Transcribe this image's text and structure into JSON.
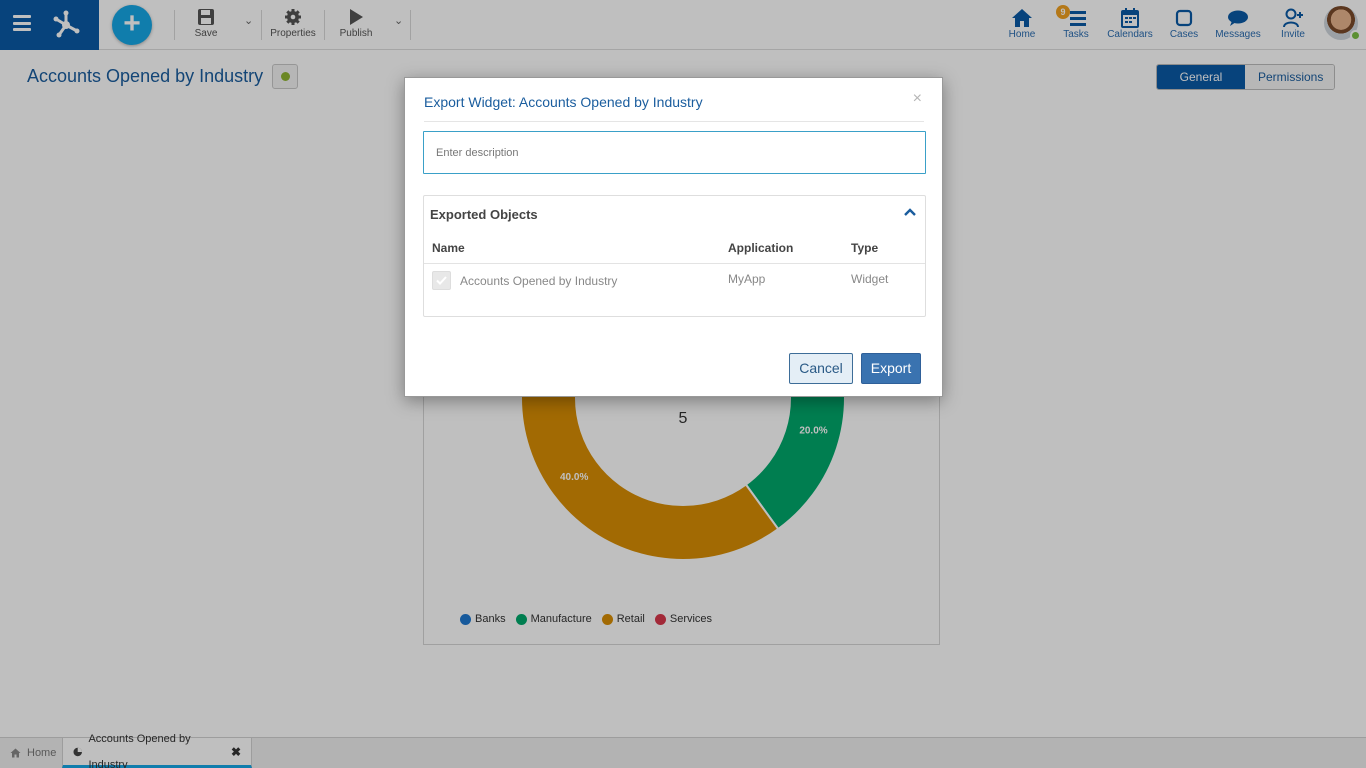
{
  "toolbar": {
    "save_label": "Save",
    "properties_label": "Properties",
    "publish_label": "Publish"
  },
  "nav": {
    "home_label": "Home",
    "tasks_label": "Tasks",
    "tasks_badge": "9",
    "calendars_label": "Calendars",
    "cases_label": "Cases",
    "messages_label": "Messages",
    "invite_label": "Invite"
  },
  "page": {
    "title": "Accounts Opened by Industry",
    "tab_general": "General",
    "tab_permissions": "Permissions"
  },
  "chart_data": {
    "type": "pie",
    "center_value": "5",
    "categories": [
      "Banks",
      "Manufacture",
      "Retail",
      "Services"
    ],
    "colors": [
      "#1f78d1",
      "#00a86b",
      "#d98e04",
      "#d9374b"
    ],
    "visible_slice_labels": [
      {
        "category": "Manufacture",
        "label": "20.0%"
      },
      {
        "category": "Retail",
        "label": "40.0%"
      }
    ],
    "legend_position": "bottom"
  },
  "modal": {
    "title": "Export Widget: Accounts Opened by Industry",
    "close_glyph": "×",
    "description_placeholder": "Enter description",
    "section_title": "Exported Objects",
    "columns": [
      "Name",
      "Application",
      "Type"
    ],
    "rows": [
      {
        "name": "Accounts Opened by Industry",
        "application": "MyApp",
        "type": "Widget",
        "checked": true
      }
    ],
    "cancel_label": "Cancel",
    "export_label": "Export"
  },
  "bottom_tabs": {
    "home_label": "Home",
    "active_label": "Accounts Opened by Industry",
    "close_glyph": "✖"
  }
}
